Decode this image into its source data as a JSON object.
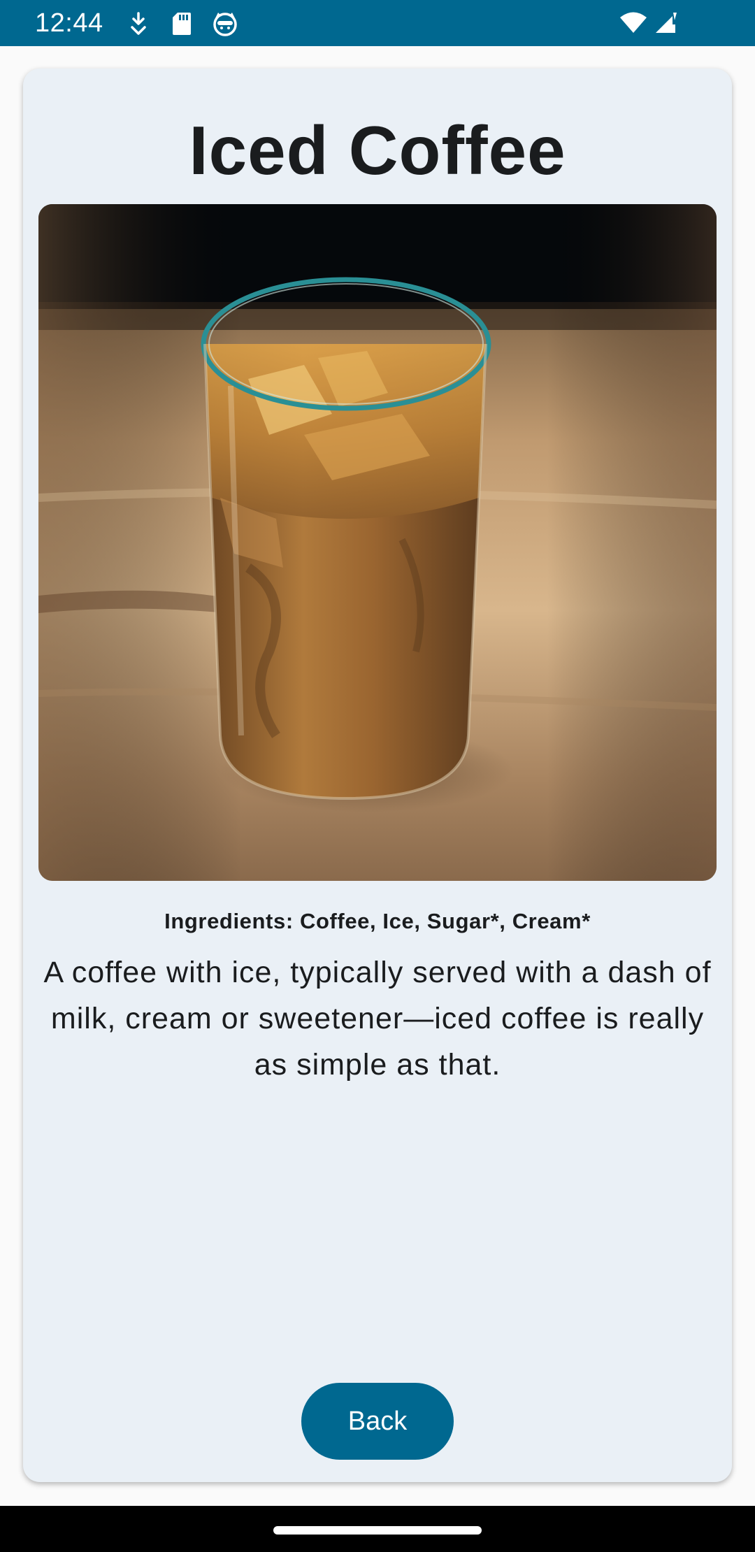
{
  "status_bar": {
    "time": "12:44",
    "icons": [
      "download-icon",
      "sd-card-icon",
      "cat-face-icon",
      "wifi-icon",
      "signal-icon"
    ]
  },
  "detail": {
    "title": "Iced Coffee",
    "image_subject": "iced-coffee-glass",
    "ingredients": "Ingredients: Coffee, Ice, Sugar*, Cream*",
    "description": "A coffee with ice, typically served with a dash of milk, cream or sweetener—iced coffee is really as simple as that."
  },
  "actions": {
    "back_label": "Back"
  },
  "colors": {
    "primary": "#006890",
    "card_background": "#eaf0f6",
    "text": "#1a1c1e"
  }
}
